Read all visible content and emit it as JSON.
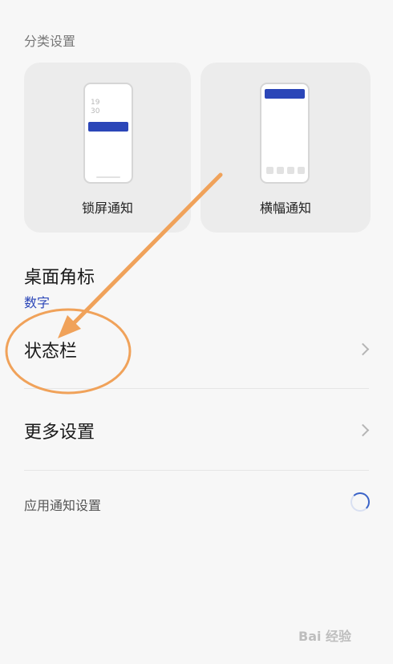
{
  "section": {
    "title": "分类设置"
  },
  "cards": [
    {
      "label": "锁屏通知",
      "clock_hour": "19",
      "clock_min": "30"
    },
    {
      "label": "横幅通知"
    }
  ],
  "desktop_badge": {
    "title": "桌面角标",
    "value": "数字"
  },
  "status_bar": {
    "title": "状态栏"
  },
  "more_settings": {
    "title": "更多设置"
  },
  "app_notification_settings": {
    "label": "应用通知设置"
  },
  "watermark": {
    "text": "Bai 经验"
  },
  "colors": {
    "accent": "#2b46b8",
    "annotation": "#f0a25a",
    "background": "#f7f7f7",
    "card": "#ececec"
  }
}
